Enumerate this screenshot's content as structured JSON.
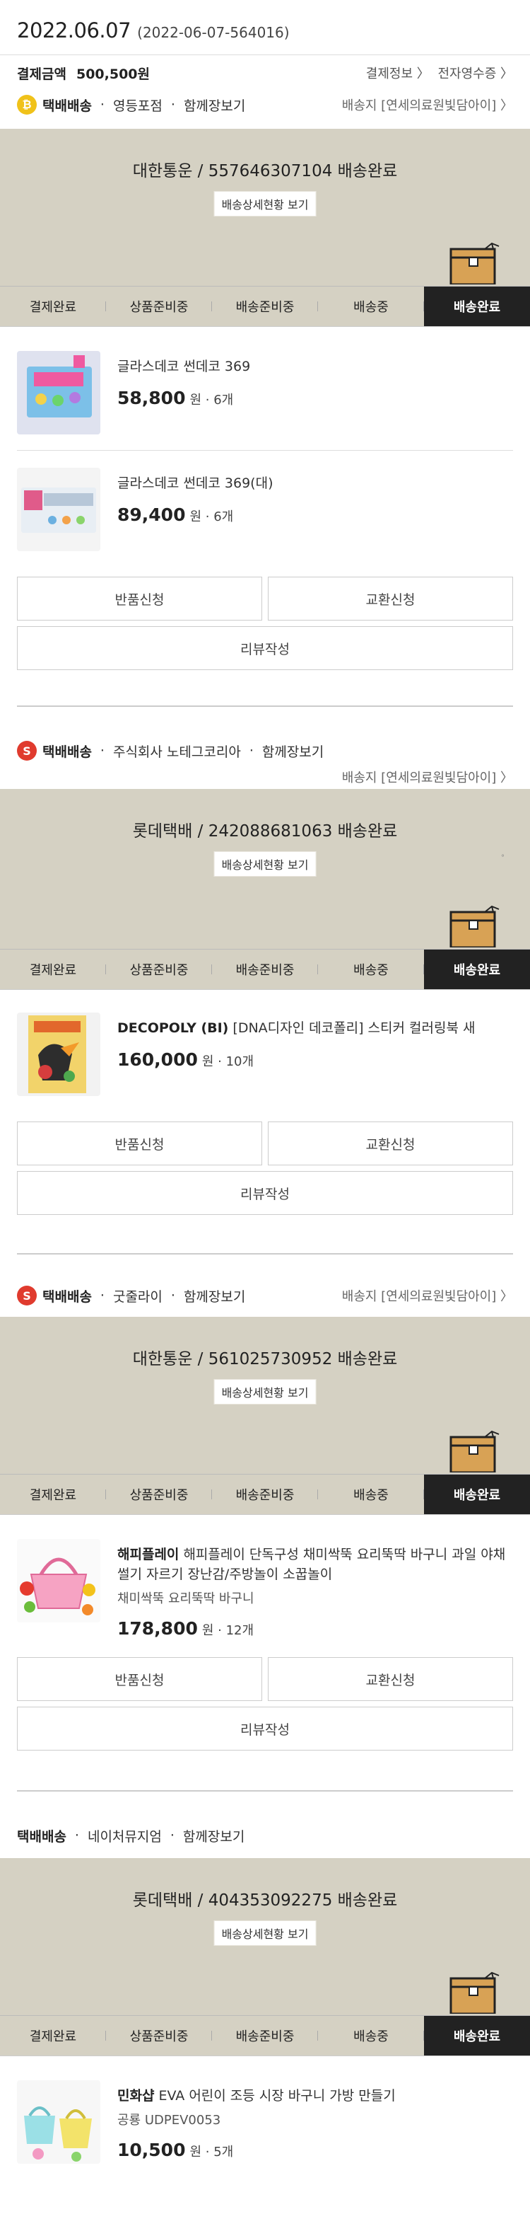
{
  "order": {
    "date": "2022.06.07",
    "order_no": "(2022-06-07-564016)",
    "pay_label": "결제금액",
    "pay_amount": "500,500원",
    "pay_info": "결제정보 〉",
    "receipt": "전자영수증 〉"
  },
  "common": {
    "detail_btn": "배송상세현황 보기",
    "addr": "배송지 [연세의료원빛담아이] 〉",
    "steps": [
      "결제완료",
      "상품준비중",
      "배송준비중",
      "배송중",
      "배송완료"
    ],
    "return_btn": "반품신청",
    "exchange_btn": "교환신청",
    "review_btn": "리뷰작성",
    "ship_type": "택배배송",
    "together": "함께장보기",
    "won": "원"
  },
  "groups": [
    {
      "badge": "₿",
      "shop": "영등포점",
      "status": "대한통운 / 557646307104 배송완료",
      "products": [
        {
          "name": "글라스데코 썬데코 369",
          "price": "58,800",
          "qty": "6개"
        },
        {
          "name": "글라스데코 썬데코 369(대)",
          "price": "89,400",
          "qty": "6개"
        }
      ]
    },
    {
      "badge": "S",
      "shop": "주식회사 노테그코리아",
      "status": "롯데택배 / 242088681063 배송완료",
      "mark": "°",
      "products": [
        {
          "brand": "DECOPOLY (BI)",
          "name": "[DNA디자인 데코폴리] 스티커 컬러링북 새",
          "price": "160,000",
          "qty": "10개"
        }
      ]
    },
    {
      "badge": "S",
      "shop": "굿줄라이",
      "status": "대한통운 / 561025730952 배송완료",
      "products": [
        {
          "brand": "해피플레이",
          "name": "해피플레이 단독구성 채미싹뚝 요리뚝딱 바구니 과일 야채 썰기 자르기 장난감/주방놀이 소꿉놀이",
          "option": "채미싹뚝 요리뚝딱 바구니",
          "price": "178,800",
          "qty": "12개"
        }
      ]
    },
    {
      "shop": "네이처뮤지엄",
      "status": "롯데택배 / 404353092275 배송완료",
      "products": [
        {
          "brand": "민화샵",
          "name": "EVA 어린이 조등 시장 바구니 가방 만들기",
          "option": "공룡 UDPEV0053",
          "price": "10,500",
          "qty": "5개"
        }
      ]
    }
  ]
}
